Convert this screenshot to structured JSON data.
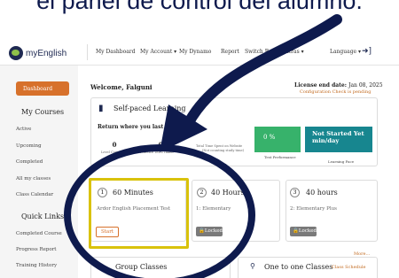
{
  "caption": "el panel de control del alumno.",
  "header": {
    "logo_text": "myEnglish",
    "nav": [
      "My Dashboard",
      "My Account ▾",
      "My Dynamo",
      "Report",
      "Switch Back",
      "Extras ▾"
    ],
    "language": "Language ▾"
  },
  "sidebar": {
    "active": "Dashboard",
    "my_courses_heading": "My Courses",
    "course_items": [
      "Active",
      "Upcoming",
      "Completed",
      "All my classes",
      "Class Calendar"
    ],
    "quick_links_heading": "Quick Links",
    "quick_items": [
      "Completed Course",
      "Progress Report",
      "Training History"
    ]
  },
  "main": {
    "welcome": "Welcome, Falguni",
    "license_label": "License end date:",
    "license_date": "Jan 08, 2025",
    "config_check": "Configuration Check is pending",
    "self_paced_title": "Self-paced Learning",
    "return_text": "Return where you last left",
    "stats": [
      {
        "value": "0",
        "label": "Level Completed"
      },
      {
        "value": "0",
        "label": "Practice Tests Taken"
      }
    ],
    "total_time_label": "Total Time Spent on Website",
    "total_time_note": "(Not counting study time)",
    "test_performance": {
      "value": "0 %",
      "label": "Test Performance"
    },
    "learning_pace": {
      "value": "Not Started Yet min/day",
      "label": "Learning Pace"
    },
    "courses": [
      {
        "num": "1",
        "title": "60 Minutes",
        "subtitle": "Ardor English Placement Test",
        "action": "Start"
      },
      {
        "num": "2",
        "title": "40 Hours",
        "subtitle": "1: Elementary",
        "action": "Locked"
      },
      {
        "num": "3",
        "title": "40 hours",
        "subtitle": "2: Elementary Plus",
        "action": "Locked"
      }
    ],
    "more": "More...",
    "group_classes": "Group Classes",
    "one_to_one": "One to one Classes",
    "class_schedule": "Class Schedule"
  },
  "colors": {
    "accent": "#d7712b",
    "navy": "#0e1a4d",
    "green": "#37b26b",
    "teal": "#17868f",
    "highlight": "#d9c20b"
  }
}
